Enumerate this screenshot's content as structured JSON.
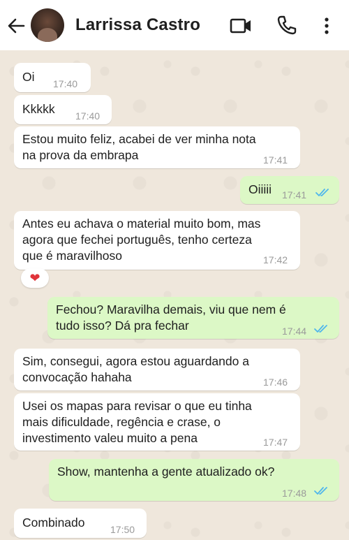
{
  "header": {
    "contact_name": "Larrissa Castro",
    "icons": [
      "back-arrow-icon",
      "video-call-icon",
      "phone-icon",
      "more-vert-icon"
    ]
  },
  "messages": [
    {
      "dir": "in",
      "text": "Oi",
      "time": "17:40"
    },
    {
      "dir": "in",
      "text": "Kkkkk",
      "time": "17:40"
    },
    {
      "dir": "in",
      "text": "Estou muito feliz, acabei de ver minha nota\nna prova da embrapa",
      "time": "17:41"
    },
    {
      "dir": "out",
      "text": "Oiiiii",
      "time": "17:41",
      "read": true
    },
    {
      "dir": "in",
      "text": "Antes eu achava o material muito bom, mas\nagora que fechei português, tenho certeza\nque é maravilhoso",
      "time": "17:42",
      "reaction": "❤"
    },
    {
      "dir": "out",
      "text": "Fechou? Maravilha demais, viu que nem é\ntudo isso? Dá pra fechar",
      "time": "17:44",
      "read": true
    },
    {
      "dir": "in",
      "text": "Sim, consegui, agora estou aguardando a\nconvocação hahaha",
      "time": "17:46"
    },
    {
      "dir": "in",
      "text": "Usei os mapas para revisar o que eu tinha\nmais dificuldade, regência e crase, o\ninvestimento valeu muito a pena",
      "time": "17:47"
    },
    {
      "dir": "out",
      "text": "Show, mantenha a gente atualizado ok?",
      "time": "17:48",
      "read": true
    },
    {
      "dir": "in",
      "text": "Combinado",
      "time": "17:50"
    }
  ],
  "colors": {
    "incoming": "#ffffff",
    "outgoing": "#dcf8c6",
    "read_ticks": "#4fb6ec",
    "background": "#efe7dc"
  }
}
